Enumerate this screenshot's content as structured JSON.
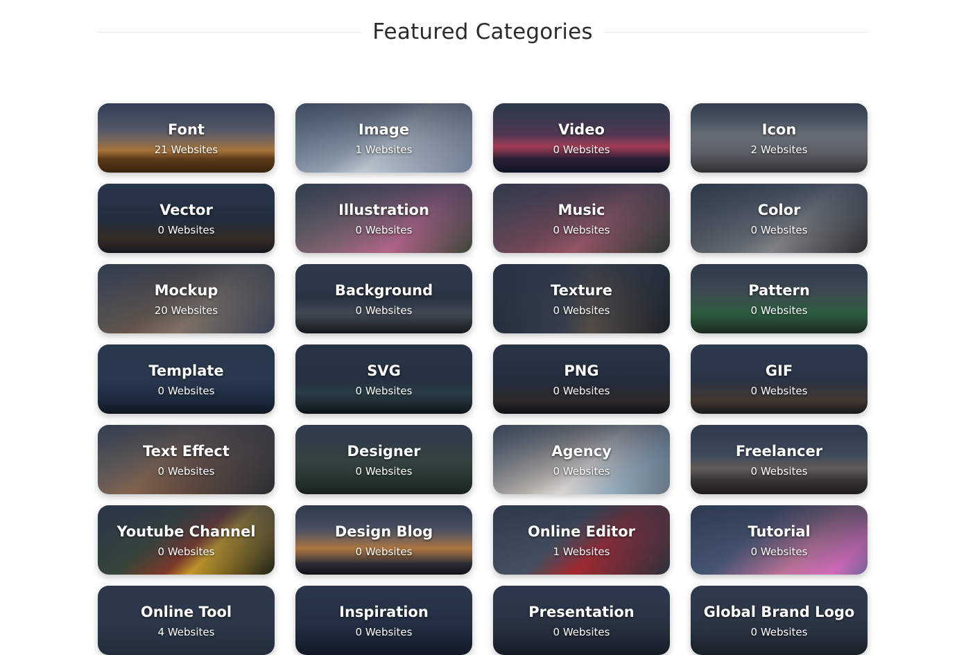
{
  "header": {
    "title": "Featured Categories"
  },
  "categories": [
    {
      "name": "Font",
      "count": "21 Websites",
      "bg": "sunset-field"
    },
    {
      "name": "Image",
      "count": "1 Websites",
      "bg": "astronaut"
    },
    {
      "name": "Video",
      "count": "0 Websites",
      "bg": "tree-sunset"
    },
    {
      "name": "Icon",
      "count": "2 Websites",
      "bg": "street"
    },
    {
      "name": "Vector",
      "count": "0 Websites",
      "bg": "city-night"
    },
    {
      "name": "Illustration",
      "count": "0 Websites",
      "bg": "flowers"
    },
    {
      "name": "Music",
      "count": "0 Websites",
      "bg": "artichoke"
    },
    {
      "name": "Color",
      "count": "0 Websites",
      "bg": "desk"
    },
    {
      "name": "Mockup",
      "count": "20 Websites",
      "bg": "mockup"
    },
    {
      "name": "Background",
      "count": "0 Websites",
      "bg": "subway"
    },
    {
      "name": "Texture",
      "count": "0 Websites",
      "bg": "alley"
    },
    {
      "name": "Pattern",
      "count": "0 Websites",
      "bg": "balls"
    },
    {
      "name": "Template",
      "count": "0 Websites",
      "bg": "tower"
    },
    {
      "name": "SVG",
      "count": "0 Websites",
      "bg": "neon"
    },
    {
      "name": "PNG",
      "count": "0 Websites",
      "bg": "night-street"
    },
    {
      "name": "GIF",
      "count": "0 Websites",
      "bg": "crowd"
    },
    {
      "name": "Text Effect",
      "count": "0 Websites",
      "bg": "typing"
    },
    {
      "name": "Designer",
      "count": "0 Websites",
      "bg": "forest"
    },
    {
      "name": "Agency",
      "count": "0 Websites",
      "bg": "agency"
    },
    {
      "name": "Freelancer",
      "count": "0 Websites",
      "bg": "sea"
    },
    {
      "name": "Youtube Channel",
      "count": "0 Websites",
      "bg": "youtube"
    },
    {
      "name": "Design Blog",
      "count": "0 Websites",
      "bg": "dusk"
    },
    {
      "name": "Online Editor",
      "count": "1 Websites",
      "bg": "glass"
    },
    {
      "name": "Tutorial",
      "count": "0 Websites",
      "bg": "gradient-blob"
    },
    {
      "name": "Online Tool",
      "count": "4 Websites",
      "bg": "skyscraper"
    },
    {
      "name": "Inspiration",
      "count": "0 Websites",
      "bg": "tower-night"
    },
    {
      "name": "Presentation",
      "count": "0 Websites",
      "bg": "present"
    },
    {
      "name": "Global Brand Logo",
      "count": "0 Websites",
      "bg": "logo"
    }
  ]
}
